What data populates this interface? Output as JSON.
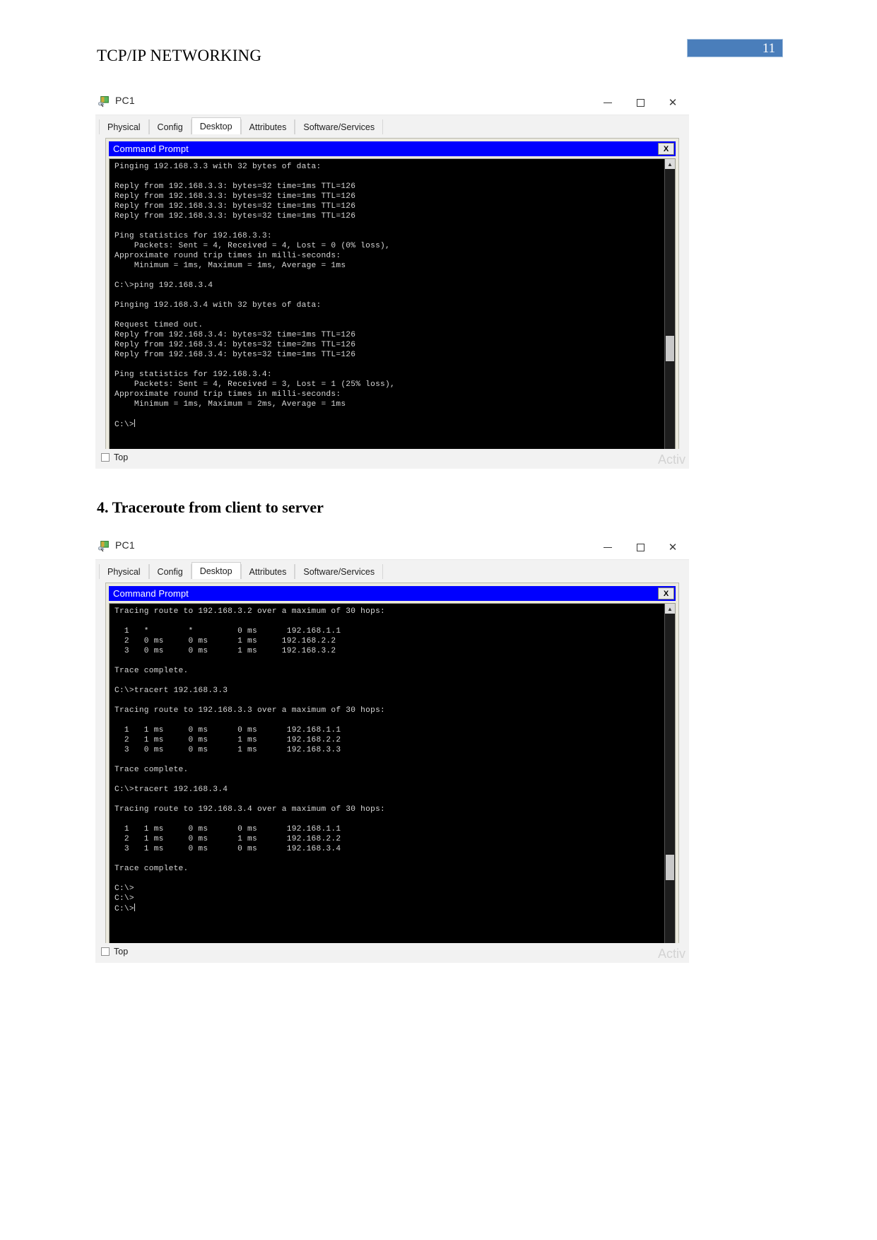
{
  "document": {
    "header_title": "TCP/IP NETWORKING",
    "page_number": "11"
  },
  "section_heading": "4. Traceroute from client to server",
  "window1": {
    "title": "PC1",
    "icon": "pc-device-icon",
    "controls": {
      "minimize": "minimize-button",
      "maximize": "maximize-button",
      "close": "✕"
    },
    "tabs": [
      {
        "label": "Physical",
        "active": false
      },
      {
        "label": "Config",
        "active": false
      },
      {
        "label": "Desktop",
        "active": true
      },
      {
        "label": "Attributes",
        "active": false
      },
      {
        "label": "Software/Services",
        "active": false
      }
    ],
    "command_prompt": {
      "title": "Command Prompt",
      "close_label": "X",
      "output": "Pinging 192.168.3.3 with 32 bytes of data:\n\nReply from 192.168.3.3: bytes=32 time=1ms TTL=126\nReply from 192.168.3.3: bytes=32 time=1ms TTL=126\nReply from 192.168.3.3: bytes=32 time=1ms TTL=126\nReply from 192.168.3.3: bytes=32 time=1ms TTL=126\n\nPing statistics for 192.168.3.3:\n    Packets: Sent = 4, Received = 4, Lost = 0 (0% loss),\nApproximate round trip times in milli-seconds:\n    Minimum = 1ms, Maximum = 1ms, Average = 1ms\n\nC:\\>ping 192.168.3.4\n\nPinging 192.168.3.4 with 32 bytes of data:\n\nRequest timed out.\nReply from 192.168.3.4: bytes=32 time=1ms TTL=126\nReply from 192.168.3.4: bytes=32 time=2ms TTL=126\nReply from 192.168.3.4: bytes=32 time=1ms TTL=126\n\nPing statistics for 192.168.3.4:\n    Packets: Sent = 4, Received = 3, Lost = 1 (25% loss),\nApproximate round trip times in milli-seconds:\n    Minimum = 1ms, Maximum = 2ms, Average = 1ms\n\nC:\\>"
    },
    "bottom": {
      "checkbox_label": "Top",
      "watermark": "Activ"
    }
  },
  "window2": {
    "title": "PC1",
    "icon": "pc-device-icon",
    "controls": {
      "minimize": "minimize-button",
      "maximize": "maximize-button",
      "close": "✕"
    },
    "tabs": [
      {
        "label": "Physical",
        "active": false
      },
      {
        "label": "Config",
        "active": false
      },
      {
        "label": "Desktop",
        "active": true
      },
      {
        "label": "Attributes",
        "active": false
      },
      {
        "label": "Software/Services",
        "active": false
      }
    ],
    "command_prompt": {
      "title": "Command Prompt",
      "close_label": "X",
      "output": "Tracing route to 192.168.3.2 over a maximum of 30 hops:\n\n  1   *        *         0 ms      192.168.1.1\n  2   0 ms     0 ms      1 ms     192.168.2.2\n  3   0 ms     0 ms      1 ms     192.168.3.2\n\nTrace complete.\n\nC:\\>tracert 192.168.3.3\n\nTracing route to 192.168.3.3 over a maximum of 30 hops:\n\n  1   1 ms     0 ms      0 ms      192.168.1.1\n  2   1 ms     0 ms      1 ms      192.168.2.2\n  3   0 ms     0 ms      1 ms      192.168.3.3\n\nTrace complete.\n\nC:\\>tracert 192.168.3.4\n\nTracing route to 192.168.3.4 over a maximum of 30 hops:\n\n  1   1 ms     0 ms      0 ms      192.168.1.1\n  2   1 ms     0 ms      1 ms      192.168.2.2\n  3   1 ms     0 ms      0 ms      192.168.3.4\n\nTrace complete.\n\nC:\\>\nC:\\>\nC:\\>"
    },
    "bottom": {
      "checkbox_label": "Top",
      "watermark": "Activ"
    }
  }
}
